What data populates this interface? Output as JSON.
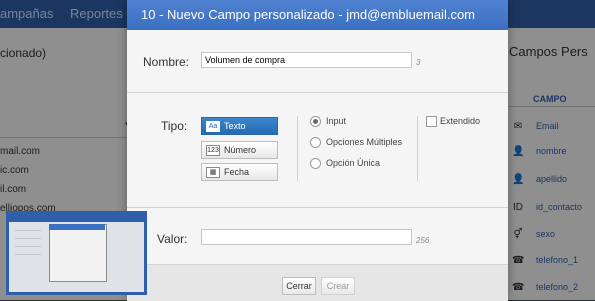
{
  "background": {
    "nav_items": [
      "ampañas",
      "Reportes"
    ],
    "left_title": "cionado)",
    "left_rows": [
      "mail.com",
      "ic.com",
      "il.com",
      "elliopos.com"
    ],
    "right_title": "Campos Pers",
    "right_column_header": "CAMPO",
    "right_rows": [
      {
        "icon": "mail-icon",
        "glyph": "✉",
        "label": "Email"
      },
      {
        "icon": "person-icon",
        "glyph": "👤",
        "label": "nombre"
      },
      {
        "icon": "person-icon",
        "glyph": "👤",
        "label": "apellido"
      },
      {
        "icon": "id-icon",
        "glyph": "ID",
        "label": "id_contacto"
      },
      {
        "icon": "gender-icon",
        "glyph": "⚥",
        "label": "sexo"
      },
      {
        "icon": "phone-icon",
        "glyph": "☎",
        "label": "telefono_1"
      },
      {
        "icon": "phone-icon",
        "glyph": "☎",
        "label": "telefono_2"
      }
    ]
  },
  "modal": {
    "title": "10 - Nuevo Campo personalizado - jmd@embluemail.com",
    "nombre": {
      "label": "Nombre:",
      "value": "Volumen de compra",
      "counter": "3"
    },
    "tipo": {
      "label": "Tipo:",
      "types": [
        {
          "icon": "text-type-icon",
          "glyph": "Aa",
          "label": "Texto",
          "selected": true
        },
        {
          "icon": "number-type-icon",
          "glyph": "123",
          "label": "Número",
          "selected": false
        },
        {
          "icon": "date-type-icon",
          "glyph": "▦",
          "label": "Fecha",
          "selected": false
        }
      ],
      "input_modes": [
        {
          "label": "Input",
          "selected": true
        },
        {
          "label": "Opciones Múltiples",
          "selected": false
        },
        {
          "label": "Opción Única",
          "selected": false
        }
      ],
      "extended": {
        "label": "Extendido",
        "checked": false
      }
    },
    "valor": {
      "label": "Valor:",
      "value": "",
      "counter": "256"
    },
    "buttons": {
      "close": "Cerrar",
      "create": "Crear"
    }
  },
  "colors": {
    "header": "#3b6fc2",
    "accent": "#2f5fa8",
    "selected_type": "#236bb4"
  }
}
